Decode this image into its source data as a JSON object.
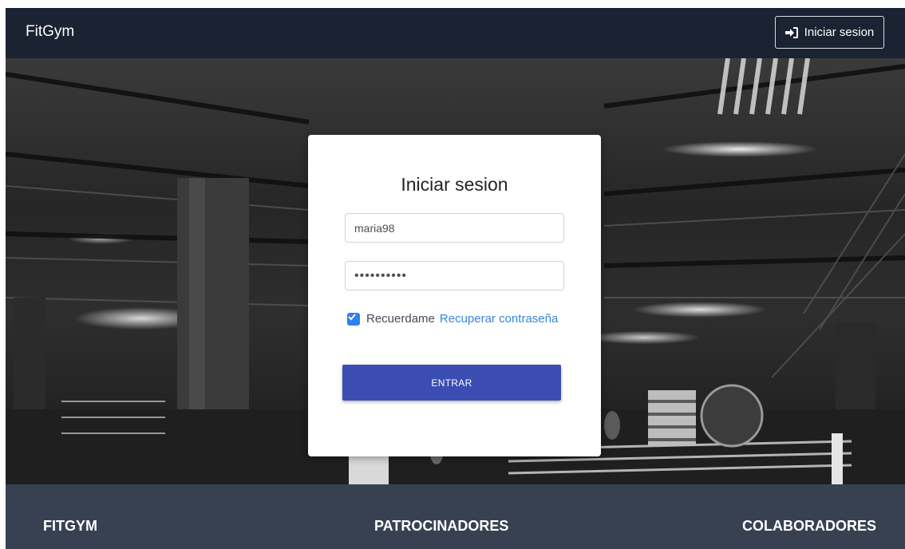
{
  "navbar": {
    "brand": "FitGym",
    "login_button_label": "Iniciar sesion",
    "login_icon": "sign-in-icon"
  },
  "login_card": {
    "title": "Iniciar sesion",
    "username_value": "maria98",
    "password_value": "••••••••••",
    "remember_label": "Recuerdame",
    "remember_checked": true,
    "recover_link": "Recuperar contraseña",
    "submit_label": "ENTRAR"
  },
  "footer": {
    "col1": "FITGYM",
    "col2": "PATROCINADORES",
    "col3": "COLABORADORES"
  },
  "colors": {
    "navbar_bg": "#1b2232",
    "footer_bg": "#374151",
    "primary_button": "#3b4db3",
    "link": "#3a86d9",
    "checkbox": "#2f80ed"
  }
}
